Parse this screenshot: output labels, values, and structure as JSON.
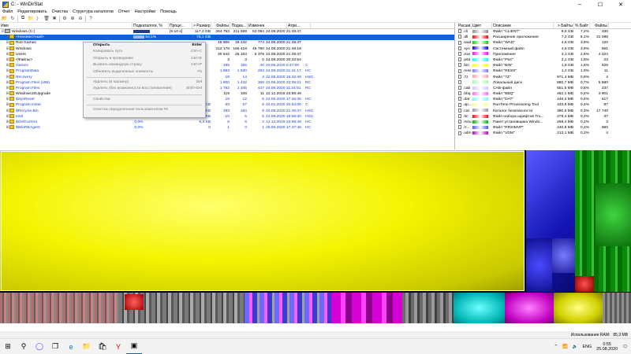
{
  "window": {
    "title": "C: - WinDirStat"
  },
  "menu": [
    "Файл",
    "Редактировать",
    "Очистка",
    "Структура каталогов",
    "Отчет",
    "Настройки",
    "Помощь"
  ],
  "tree": {
    "columns": [
      "Имя",
      "Подкаталоги, %",
      "Проце...",
      "> Размер",
      "Файлы",
      "Подка...",
      "Изменен",
      "Атри..."
    ],
    "rows": [
      {
        "indent": 0,
        "exp": "⊟",
        "icon": "drive",
        "name": "Windows (C:)",
        "pct": "",
        "pctfill": 0.97,
        "proc": "[5:10 s]",
        "size": "117,3 GB",
        "files": "264 753",
        "sub": "211 659",
        "total": "53 094",
        "mod": "24.08.2020 21:49:47",
        "attr": "",
        "cls": ""
      },
      {
        "indent": 1,
        "exp": "⊞",
        "icon": "folder",
        "name": "<Неизвестный>",
        "pct": "64,1%",
        "pctfill": 0.64,
        "proc": "",
        "size": "75,1 GB",
        "files": "",
        "sub": "",
        "total": "",
        "mod": "",
        "attr": "",
        "cls": "sel"
      },
      {
        "indent": 1,
        "exp": "⊞",
        "icon": "folder",
        "name": "Riot Games",
        "pct": "",
        "pctfill": 0,
        "proc": "",
        "size": "",
        "files": "15 906",
        "sub": "15 132",
        "total": "774",
        "mod": "24.08.2020 21:49:47",
        "attr": "",
        "cls": ""
      },
      {
        "indent": 1,
        "exp": "⊞",
        "icon": "folder",
        "name": "Windows",
        "pct": "",
        "pctfill": 0,
        "proc": "",
        "size": "",
        "files": "212 178",
        "sub": "166 418",
        "total": "45 760",
        "mod": "24.08.2020 21:48:18",
        "attr": "",
        "cls": ""
      },
      {
        "indent": 1,
        "exp": "⊞",
        "icon": "folder",
        "name": "Users",
        "pct": "",
        "pctfill": 0,
        "proc": "",
        "size": "",
        "files": "30 542",
        "sub": "25 163",
        "total": "5 379",
        "mod": "24.08.2020 21:49:47",
        "attr": "",
        "cls": ""
      },
      {
        "indent": 1,
        "exp": "⊞",
        "icon": "files",
        "name": "<Файлы>",
        "pct": "",
        "pctfill": 0,
        "proc": "",
        "size": "",
        "files": "3",
        "sub": "3",
        "total": "0",
        "mod": "24.08.2020 20:43:54",
        "attr": "",
        "cls": ""
      },
      {
        "indent": 1,
        "exp": "⊞",
        "icon": "folder",
        "name": "Games",
        "pct": "",
        "pctfill": 0,
        "proc": "",
        "size": "",
        "files": "195",
        "sub": "155",
        "total": "40",
        "mod": "20.08.2020 0:47:00",
        "attr": "C",
        "cls": "blue"
      },
      {
        "indent": 1,
        "exp": "⊞",
        "icon": "folder",
        "name": "ProgramData",
        "pct": "",
        "pctfill": 0,
        "proc": "",
        "size": "",
        "files": "1 883",
        "sub": "1 630",
        "total": "293",
        "mod": "24.08.2020 21:41:17",
        "attr": "HC",
        "cls": "blue"
      },
      {
        "indent": 1,
        "exp": "⊞",
        "icon": "folder",
        "name": "Recovery",
        "pct": "",
        "pctfill": 0,
        "proc": "",
        "size": "",
        "files": "18",
        "sub": "14",
        "total": "4",
        "mod": "22.08.2020 16:42:49",
        "attr": "HSC",
        "cls": "blue"
      },
      {
        "indent": 1,
        "exp": "⊞",
        "icon": "folder",
        "name": "Program Files (x86)",
        "pct": "",
        "pctfill": 0,
        "proc": "",
        "size": "",
        "files": "1 800",
        "sub": "1 432",
        "total": "368",
        "mod": "22.08.2020 23:39:21",
        "attr": "RC",
        "cls": "blue"
      },
      {
        "indent": 1,
        "exp": "⊞",
        "icon": "folder",
        "name": "Program Files",
        "pct": "",
        "pctfill": 0,
        "proc": "",
        "size": "",
        "files": "1 792",
        "sub": "1 345",
        "total": "447",
        "mod": "24.08.2020 11:34:51",
        "attr": "RC",
        "cls": "blue"
      },
      {
        "indent": 1,
        "exp": "⊞",
        "icon": "folder",
        "name": "Windows10Upgrade",
        "pct": "",
        "pctfill": 0,
        "proc": "",
        "size": "",
        "files": "119",
        "sub": "108",
        "total": "11",
        "mod": "12.12.2019 23:58:49",
        "attr": "",
        "cls": ""
      },
      {
        "indent": 1,
        "exp": "⊞",
        "icon": "folder",
        "name": "$SysReset",
        "pct": "",
        "pctfill": 0,
        "proc": "",
        "size": "",
        "files": "18",
        "sub": "12",
        "total": "6",
        "mod": "22.06.2020 17:26:35",
        "attr": "HC",
        "cls": "blue"
      },
      {
        "indent": 1,
        "exp": "⊞",
        "icon": "folder",
        "name": "Program instal",
        "pct": "",
        "pctfill": 0.12,
        "proc": "",
        "size": "1,0 GB",
        "files": "63",
        "sub": "57",
        "total": "6",
        "mod": "24.01.2020 20:54:06",
        "attr": "C",
        "cls": "blue"
      },
      {
        "indent": 1,
        "exp": "⊞",
        "icon": "folder",
        "name": "$Recycle.Bin",
        "pct": "0,0%",
        "pctfill": 0.05,
        "proc": "",
        "size": "46,1 KB",
        "files": "193",
        "sub": "184",
        "total": "9",
        "mod": "24.08.2020 21:49:47",
        "attr": "HSC",
        "cls": "blue"
      },
      {
        "indent": 1,
        "exp": "⊞",
        "icon": "folder",
        "name": "Intel",
        "pct": "0,0%",
        "pctfill": 0.04,
        "proc": "",
        "size": "40,3 KB",
        "files": "10",
        "sub": "5",
        "total": "5",
        "mod": "22.08.2020 16:59:30",
        "attr": "HSC",
        "cls": "blue"
      },
      {
        "indent": 1,
        "exp": "⊞",
        "icon": "folder",
        "name": "$GetCurrent",
        "pct": "0,0%",
        "pctfill": 0.02,
        "proc": "",
        "size": "8,3 KB",
        "files": "8",
        "sub": "6",
        "total": "2",
        "mod": "12.12.2019 23:58:49",
        "attr": "HC",
        "cls": "blue"
      },
      {
        "indent": 1,
        "exp": "⊞",
        "icon": "folder",
        "name": "$WinREAgent",
        "pct": "0,0%",
        "pctfill": 0.01,
        "proc": "",
        "size": "0",
        "files": "1",
        "sub": "0",
        "total": "1",
        "mod": "25.06.2020 17:47:48",
        "attr": "HC",
        "cls": "blue"
      }
    ]
  },
  "context_menu": [
    {
      "label": "Открыть",
      "key": "Enter",
      "def": true,
      "sep": false
    },
    {
      "label": "Копировать путь",
      "key": "Ctrl+C",
      "def": false,
      "sep": false
    },
    {
      "label": "Открыть в проводнике",
      "key": "Ctrl+E",
      "def": false,
      "sep": false
    },
    {
      "label": "Вызвать командную строку",
      "key": "Ctrl+P",
      "def": false,
      "sep": false
    },
    {
      "label": "Обновить выделенные элементы",
      "key": "F5",
      "def": false,
      "sep": true
    },
    {
      "label": "Удалить (в корзину)",
      "key": "Del",
      "def": false,
      "sep": false
    },
    {
      "label": "Удалить (без возможности восстановления)",
      "key": "Shift+Del",
      "def": false,
      "sep": true
    },
    {
      "label": "Свойства",
      "key": "",
      "def": false,
      "sep": true
    },
    {
      "label": "Очистка определенная пользователем #0",
      "key": "",
      "def": false,
      "sep": false
    }
  ],
  "extensions": {
    "columns": [
      "Расши...",
      "Цвет",
      "Описание",
      "> Байты",
      "% Байт",
      "Файлы"
    ],
    "rows": [
      {
        "ext": ".cli",
        "color": "#8d8d8d",
        "desc": "Файл \"CLIENT\"",
        "bytes": "8,5 GB",
        "pct": "7,2%",
        "files": "330"
      },
      {
        "ext": ".dll",
        "color": "#ff0000",
        "desc": "Расширение приложения",
        "bytes": "7,2 GB",
        "pct": "6,1%",
        "files": "31 098"
      },
      {
        "ext": ".wad",
        "color": "#00d900",
        "desc": "Файл \"WAD\"",
        "bytes": "4,6 GB",
        "pct": "3,9%",
        "files": "120"
      },
      {
        "ext": ".sys",
        "color": "#0000ff",
        "desc": "Системный файл",
        "bytes": "4,6 GB",
        "pct": "3,9%",
        "files": "561"
      },
      {
        "ext": ".exe",
        "color": "#ff00ff",
        "desc": "Приложение",
        "bytes": "3,1 GB",
        "pct": "2,6%",
        "files": "4 324"
      },
      {
        "ext": ".p64",
        "color": "#00ffff",
        "desc": "Файл \"P64\"",
        "bytes": "2,1 GB",
        "pct": "1,8%",
        "files": "23"
      },
      {
        "ext": ".bin",
        "color": "#ffff00",
        "desc": "Файл \"BIN\"",
        "bytes": "1,8 GB",
        "pct": "1,5%",
        "files": "529"
      },
      {
        "ext": ".ress",
        "color": "#7878ff",
        "desc": "Файл \"RESS\"",
        "bytes": "1,2 GB",
        "pct": "1,0%",
        "files": "11"
      },
      {
        "ext": ".7z",
        "color": "#ff9f9f",
        "desc": "Файл \"7Z\"",
        "bytes": "971,4 MB",
        "pct": "0,8%",
        "files": "4"
      },
      {
        "ext": "",
        "color": "#9fff9f",
        "desc": "Локальный диск",
        "bytes": "880,7 MB",
        "pct": "0,7%",
        "files": "5 580"
      },
      {
        "ext": ".cab",
        "color": "#c8c8ff",
        "desc": "CAB-файл",
        "bytes": "551,5 MB",
        "pct": "0,5%",
        "files": "237"
      },
      {
        "ext": ".bbq",
        "color": "#ff64ff",
        "desc": "Файл \"BBQ\"",
        "bytes": "462,1 MB",
        "pct": "0,4%",
        "files": "3 901"
      },
      {
        "ext": ".dat",
        "color": "#64ffff",
        "desc": "Файл \"DAT\"",
        "bytes": "446,2 MB",
        "pct": "0,4%",
        "files": "617"
      },
      {
        "ext": ".ap...",
        "color": "#ffff96",
        "desc": "RunTime Provisioning Tool",
        "bytes": "433,8 MB",
        "pct": "0,4%",
        "files": "87"
      },
      {
        "ext": ".cat",
        "color": "#969696",
        "desc": "Каталог безопасности",
        "bytes": "380,5 MB",
        "pct": "0,3%",
        "files": "17 740"
      },
      {
        "ext": ".ttc",
        "color": "#ff0000",
        "desc": "Файл набора шрифтов Tru...",
        "bytes": "279,4 MB",
        "pct": "0,2%",
        "files": "37"
      },
      {
        "ext": ".msu",
        "color": "#00b400",
        "desc": "Пакет установщика Windo...",
        "bytes": "258,4 MB",
        "pct": "0,2%",
        "files": "3"
      },
      {
        "ext": ".rr...",
        "color": "#5050ff",
        "desc": "Файл \"RRSIMVP\"",
        "bytes": "240,8 MB",
        "pct": "0,2%",
        "files": "960"
      },
      {
        "ext": ".vdm",
        "color": "#b400b4",
        "desc": "Файл \"VDM\"",
        "bytes": "213,1 MB",
        "pct": "0,2%",
        "files": "4"
      }
    ]
  },
  "status": {
    "ram_label": "Использование RAM:",
    "ram_value": "85,3 MB"
  },
  "taskbar": {
    "lang": "ENG",
    "time": "0:55",
    "date": "25.08.2020"
  },
  "colors": {
    "selection": "#0a64d6",
    "yellow_block": "#ffff00"
  }
}
